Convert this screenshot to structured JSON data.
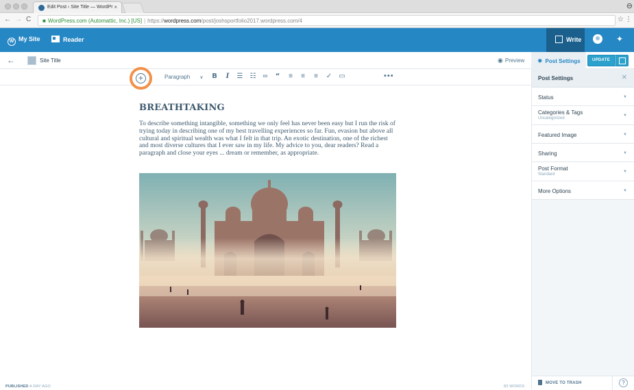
{
  "browser": {
    "tab_title": "Edit Post ‹ Site Title — WordPr",
    "tab_close": "×",
    "address": {
      "secure_label": "WordPress.com (Automattic, Inc.) [US]",
      "url_scheme": "https://",
      "url_host": "wordpress.com",
      "url_path": "/post/joshsportfolio2017.wordpress.com/4"
    }
  },
  "masterbar": {
    "my_site": "My Site",
    "reader": "Reader",
    "write": "Write",
    "accent": "#2687c5"
  },
  "editor": {
    "site_title": "Site Title",
    "preview": "Preview",
    "post_settings": "Post Settings",
    "update": "UPDATE",
    "format_select": "Paragraph",
    "more": "•••"
  },
  "toolbar_icons": [
    "bold-icon",
    "italic-icon",
    "bulleted-list-icon",
    "numbered-list-icon",
    "link-icon",
    "blockquote-icon",
    "align-left-icon",
    "align-center-icon",
    "align-right-icon",
    "spellcheck-icon",
    "read-more-icon"
  ],
  "post": {
    "title": "BREATHTAKING",
    "body": "To describe something intangible, something we only feel has never been easy but I run the risk of trying today in describing one of my best travelling experiences so far. Fun, evasion but above all cultural and spiritual wealth was what I felt in that trip. An exotic destination, one of the richest and most diverse cultures that I ever saw in my life. My advice to you, dear readers? Read a paragraph and close your eyes ... dream or remember, as appropriate."
  },
  "status": {
    "published_label": "PUBLISHED",
    "published_when": "A DAY AGO",
    "word_count": "83 WORDS"
  },
  "sidebar": {
    "header": "Post Settings",
    "sections": [
      {
        "label": "Status",
        "sub": ""
      },
      {
        "label": "Categories & Tags",
        "sub": "Uncategorized"
      },
      {
        "label": "Featured Image",
        "sub": ""
      },
      {
        "label": "Sharing",
        "sub": ""
      },
      {
        "label": "Post Format",
        "sub": "Standard"
      },
      {
        "label": "More Options",
        "sub": ""
      }
    ],
    "trash": "MOVE TO TRASH",
    "help": "?"
  },
  "highlight_color": "#f2914a"
}
